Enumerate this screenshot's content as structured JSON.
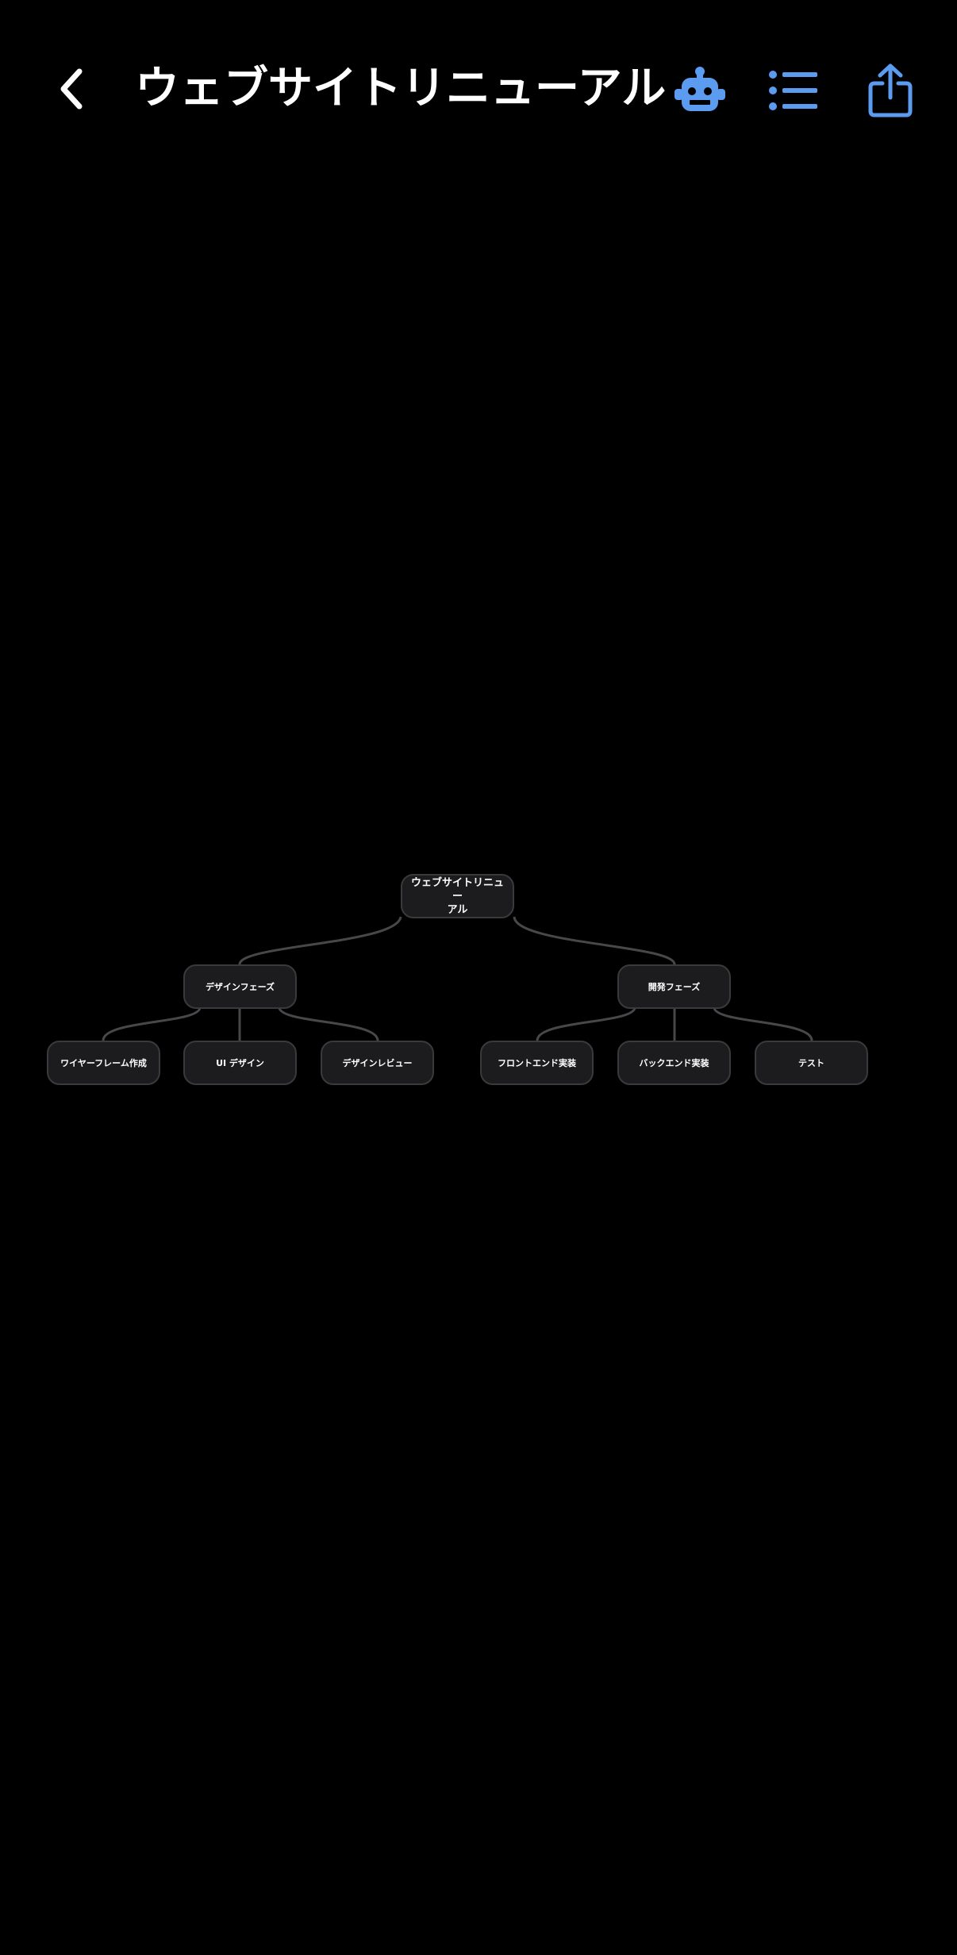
{
  "header": {
    "title": "ウェブサイトリニューアル",
    "back_icon": "chevron-left-icon",
    "robot_icon": "robot-icon",
    "list_icon": "list-icon",
    "share_icon": "share-icon",
    "accent_color": "#5b9cf0"
  },
  "mindmap": {
    "root": {
      "label": "ウェブサイトリニュー\nアル"
    },
    "branches": [
      {
        "label": "デザインフェーズ",
        "children": [
          {
            "label": "ワイヤーフレーム作成"
          },
          {
            "label": "UI デザイン"
          },
          {
            "label": "デザインレビュー"
          }
        ]
      },
      {
        "label": "開発フェーズ",
        "children": [
          {
            "label": "フロントエンド実装"
          },
          {
            "label": "バックエンド実装"
          },
          {
            "label": "テスト"
          }
        ]
      }
    ],
    "node_bg": "#1c1c1e",
    "node_border": "#3a3a3c",
    "connector_color": "#48484a"
  }
}
